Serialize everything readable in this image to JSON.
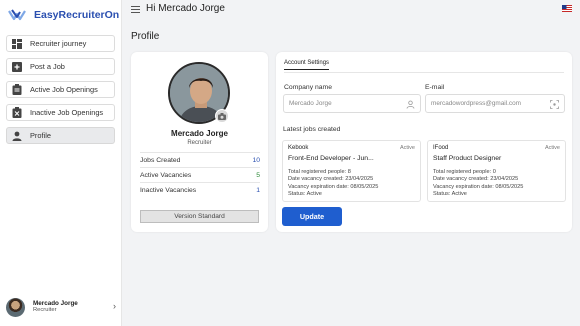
{
  "app": {
    "name": "EasyRecruiterOn"
  },
  "sidebar": {
    "items": [
      {
        "label": "Recruiter journey",
        "icon": "dashboard-icon"
      },
      {
        "label": "Post a Job",
        "icon": "add-box-icon"
      },
      {
        "label": "Active Job Openings",
        "icon": "clipboard-icon"
      },
      {
        "label": "Inactive Job Openings",
        "icon": "clipboard-x-icon"
      },
      {
        "label": "Profile",
        "icon": "person-icon",
        "active": true
      }
    ],
    "user": {
      "name": "Mercado Jorge",
      "role": "Recruiter"
    }
  },
  "header": {
    "greeting": "Hi Mercado Jorge",
    "flag": "us-flag-icon"
  },
  "page": {
    "title": "Profile"
  },
  "profile": {
    "name": "Mercado Jorge",
    "role": "Recruiter",
    "stats": [
      {
        "label": "Jobs Created",
        "value": "10",
        "color": "#2a4fb0"
      },
      {
        "label": "Active Vacancies",
        "value": "5",
        "color": "#2e8b3a"
      },
      {
        "label": "Inactive Vacancies",
        "value": "1",
        "color": "#2a4fb0"
      }
    ],
    "version": "Version Standard"
  },
  "account": {
    "tab": "Account Settings",
    "company_label": "Company name",
    "company_value": "Mercado Jorge",
    "email_label": "E-mail",
    "email_value": "mercadowordpress@gmail.com",
    "latest_jobs_label": "Latest jobs created",
    "jobs": [
      {
        "company": "Kebook",
        "status": "Active",
        "title": "Front-End Developer - Jun...",
        "registered": "Total registered people: 8",
        "created": "Date vacancy created: 23/04/2025",
        "expires": "Vacancy expiration date: 08/05/2025",
        "status_line": "Status: Active"
      },
      {
        "company": "IFood",
        "status": "Active",
        "title": "Staff Product Designer",
        "registered": "Total registered people: 0",
        "created": "Date vacancy created: 23/04/2025",
        "expires": "Vacancy expiration date: 08/05/2025",
        "status_line": "Status: Active"
      }
    ],
    "update_label": "Update"
  }
}
